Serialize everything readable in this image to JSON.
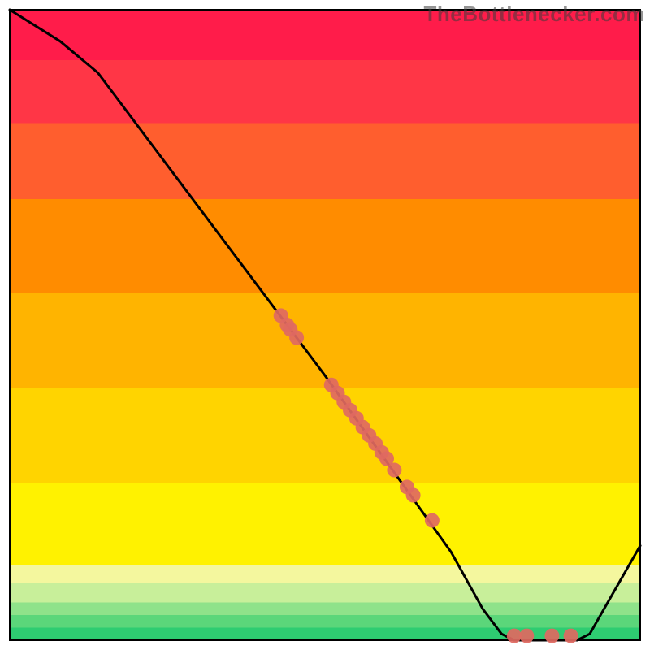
{
  "watermark": "TheBottlenecker.com",
  "chart_data": {
    "type": "line",
    "title": "",
    "xlabel": "",
    "ylabel": "",
    "xlim": [
      0,
      100
    ],
    "ylim": [
      0,
      100
    ],
    "curve": [
      {
        "x": 0,
        "y": 100
      },
      {
        "x": 8,
        "y": 95
      },
      {
        "x": 14,
        "y": 90
      },
      {
        "x": 50,
        "y": 42
      },
      {
        "x": 70,
        "y": 14
      },
      {
        "x": 75,
        "y": 5
      },
      {
        "x": 78,
        "y": 1
      },
      {
        "x": 80,
        "y": 0
      },
      {
        "x": 90,
        "y": 0
      },
      {
        "x": 92,
        "y": 1
      },
      {
        "x": 100,
        "y": 15
      }
    ],
    "scatter": [
      {
        "x": 43.0,
        "y": 51.5
      },
      {
        "x": 44.0,
        "y": 50.0
      },
      {
        "x": 44.5,
        "y": 49.3
      },
      {
        "x": 45.5,
        "y": 48.0
      },
      {
        "x": 51.0,
        "y": 40.5
      },
      {
        "x": 52.0,
        "y": 39.2
      },
      {
        "x": 53.0,
        "y": 37.8
      },
      {
        "x": 54.0,
        "y": 36.5
      },
      {
        "x": 55.0,
        "y": 35.2
      },
      {
        "x": 56.0,
        "y": 33.8
      },
      {
        "x": 57.0,
        "y": 32.5
      },
      {
        "x": 58.0,
        "y": 31.2
      },
      {
        "x": 59.0,
        "y": 29.8
      },
      {
        "x": 59.8,
        "y": 28.8
      },
      {
        "x": 61.0,
        "y": 27.0
      },
      {
        "x": 63.0,
        "y": 24.3
      },
      {
        "x": 64.0,
        "y": 23.0
      },
      {
        "x": 67.0,
        "y": 19.0
      },
      {
        "x": 80.0,
        "y": 0.7
      },
      {
        "x": 82.0,
        "y": 0.7
      },
      {
        "x": 86.0,
        "y": 0.7
      },
      {
        "x": 89.0,
        "y": 0.7
      }
    ],
    "background_bands": [
      {
        "y0": 0,
        "y1": 2,
        "color": "#2ecc71"
      },
      {
        "y0": 2,
        "y1": 4,
        "color": "#5bd67a"
      },
      {
        "y0": 4,
        "y1": 6,
        "color": "#8fe28a"
      },
      {
        "y0": 6,
        "y1": 9,
        "color": "#c8ef9a"
      },
      {
        "y0": 9,
        "y1": 12,
        "color": "#f4f79e"
      },
      {
        "y0": 12,
        "y1": 25,
        "color": "#fff200"
      },
      {
        "y0": 25,
        "y1": 40,
        "color": "#ffd400"
      },
      {
        "y0": 40,
        "y1": 55,
        "color": "#ffb400"
      },
      {
        "y0": 55,
        "y1": 70,
        "color": "#ff8c00"
      },
      {
        "y0": 70,
        "y1": 82,
        "color": "#ff5e2e"
      },
      {
        "y0": 82,
        "y1": 92,
        "color": "#ff3646"
      },
      {
        "y0": 92,
        "y1": 100,
        "color": "#ff1c4a"
      }
    ],
    "colors": {
      "curve": "#000000",
      "scatter": "#e06961",
      "frame": "#000000"
    }
  }
}
